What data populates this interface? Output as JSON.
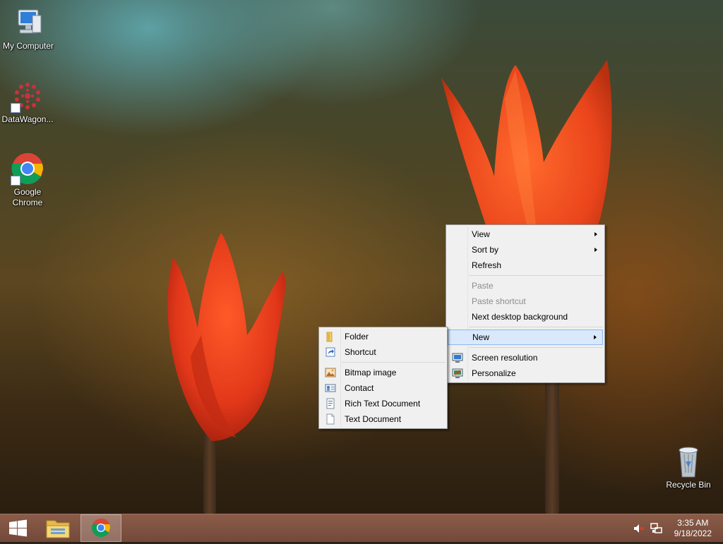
{
  "desktop_icons": {
    "my_computer": "My Computer",
    "datawagon": "DataWagon...",
    "chrome_line1": "Google",
    "chrome_line2": "Chrome",
    "recycle_bin": "Recycle Bin"
  },
  "context_menu": {
    "view": "View",
    "sort_by": "Sort by",
    "refresh": "Refresh",
    "paste": "Paste",
    "paste_shortcut": "Paste shortcut",
    "next_background": "Next desktop background",
    "new": "New",
    "screen_resolution": "Screen resolution",
    "personalize": "Personalize"
  },
  "new_submenu": {
    "folder": "Folder",
    "shortcut": "Shortcut",
    "bitmap": "Bitmap image",
    "contact": "Contact",
    "rtf": "Rich Text Document",
    "text": "Text Document"
  },
  "taskbar": {
    "time": "3:35 AM",
    "date": "9/18/2022"
  },
  "colors": {
    "menu_highlight": "#d9e8fb",
    "taskbar": "#7a4f3e",
    "tulip": "#e8421a"
  }
}
